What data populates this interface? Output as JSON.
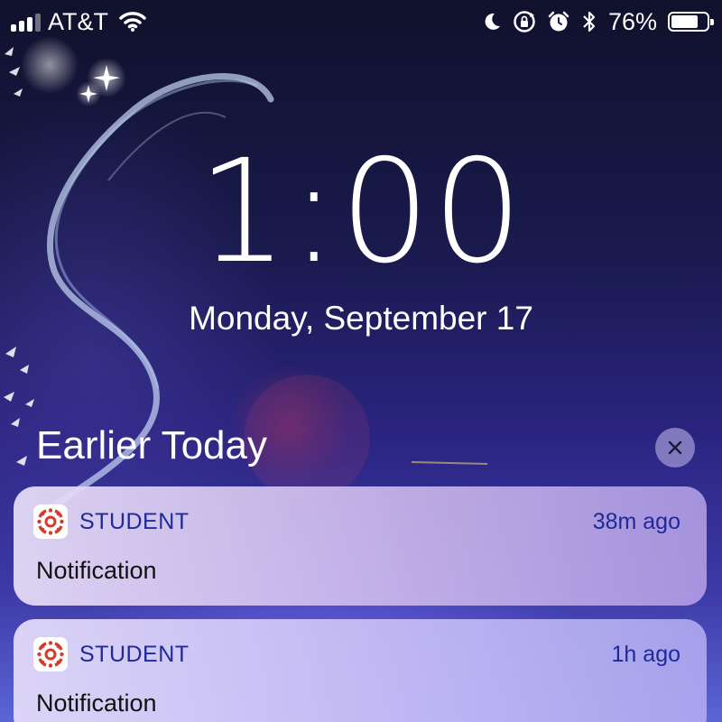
{
  "status_bar": {
    "carrier": "AT&T",
    "battery_percent": "76%",
    "battery_level": 0.76,
    "icons": [
      "signal-icon",
      "wifi-icon",
      "moon-icon",
      "rotation-lock-icon",
      "alarm-icon",
      "bluetooth-icon",
      "battery-icon"
    ]
  },
  "lock_screen": {
    "time": "1:00",
    "date": "Monday, September 17"
  },
  "notification_center": {
    "section_title": "Earlier Today",
    "clear_icon": "close-icon",
    "notifications": [
      {
        "app_name": "STUDENT",
        "time_ago": "38m ago",
        "message": "Notification",
        "icon": "canvas-app-icon"
      },
      {
        "app_name": "STUDENT",
        "time_ago": "1h ago",
        "message": "Notification",
        "icon": "canvas-app-icon"
      }
    ]
  },
  "colors": {
    "app_name_text": "#1f2a9a",
    "canvas_red": "#d43b2c",
    "background_top": "#10112c",
    "background_bottom": "#5b66d6"
  }
}
